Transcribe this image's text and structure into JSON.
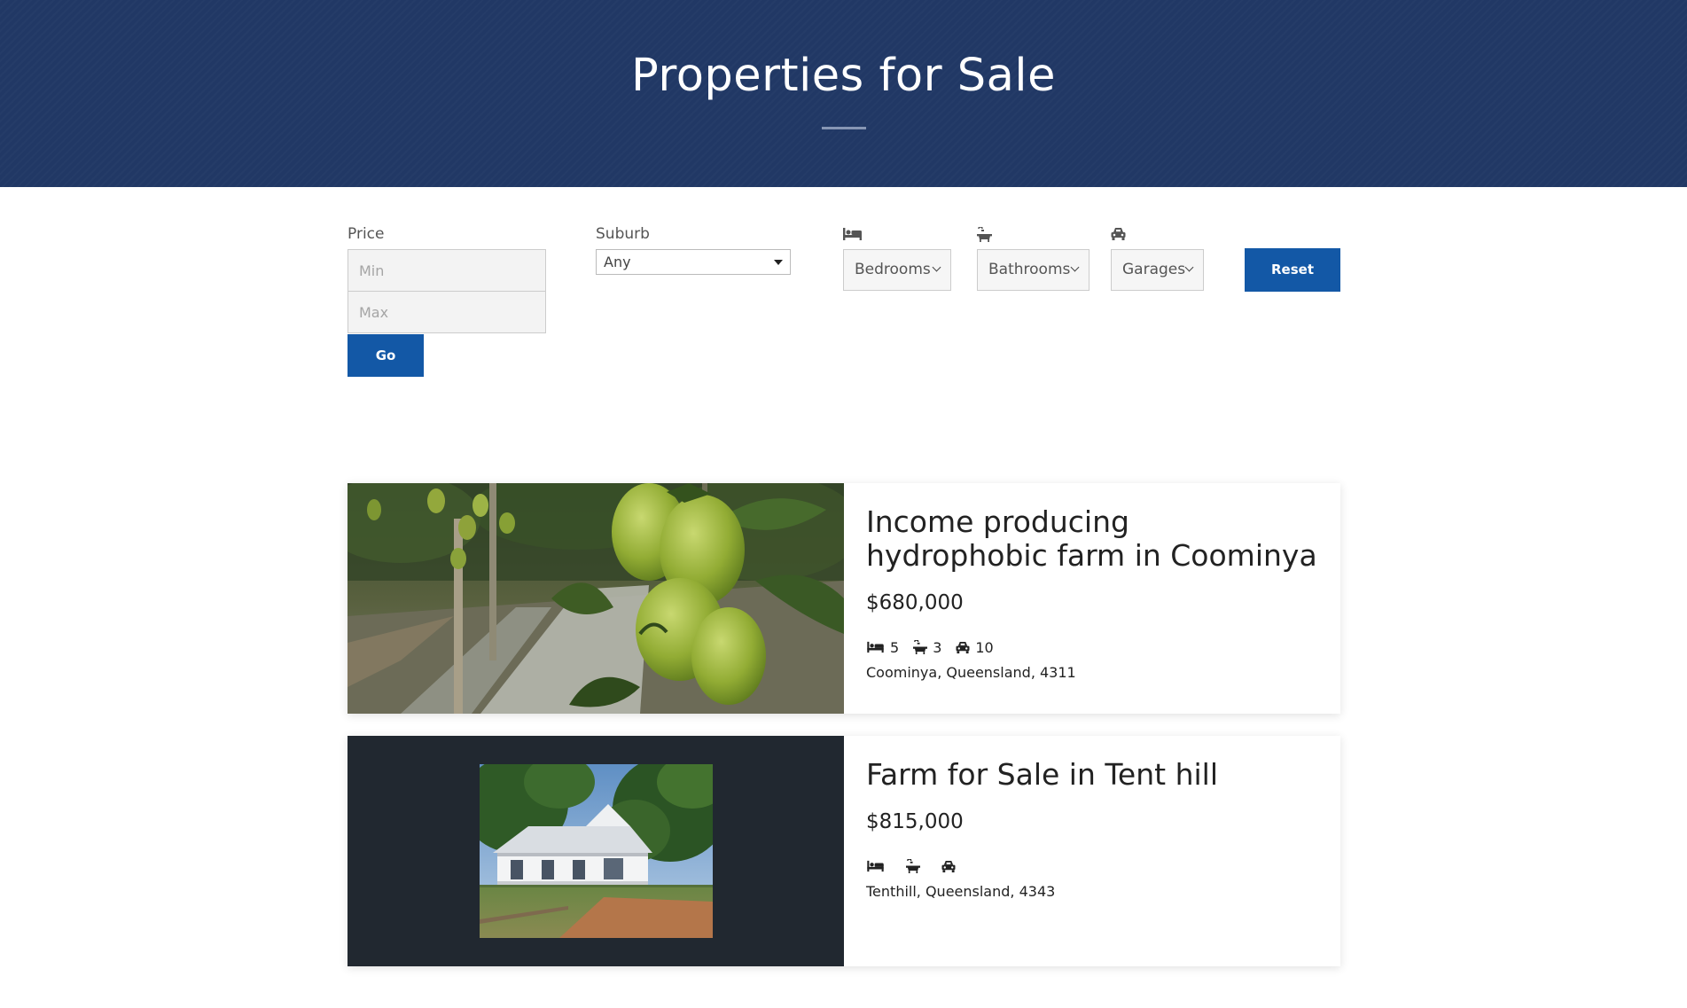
{
  "header": {
    "title": "Properties for Sale"
  },
  "filters": {
    "price_label": "Price",
    "min_placeholder": "Min",
    "max_placeholder": "Max",
    "go_label": "Go",
    "suburb_label": "Suburb",
    "suburb_value": "Any",
    "bedrooms_value": "Bedrooms",
    "bathrooms_value": "Bathrooms",
    "garages_value": "Garages",
    "reset_label": "Reset",
    "icons": [
      "bed-icon",
      "bath-icon",
      "car-icon"
    ]
  },
  "listings": [
    {
      "title": "Income producing hydrophobic farm in Coominya",
      "price": "$680,000",
      "bedrooms": "5",
      "bathrooms": "3",
      "garages": "10",
      "address": "Coominya, Queensland, 4311",
      "image": "tomato-plants-photo"
    },
    {
      "title": "Farm for Sale in Tent hill",
      "price": "$815,000",
      "bedrooms": "",
      "bathrooms": "",
      "garages": "",
      "address": "Tenthill, Queensland, 4343",
      "image": "farmhouse-photo"
    }
  ],
  "colors": {
    "header_bg": "#213865",
    "button_blue": "#1358a6",
    "dark_media_bg": "#212830"
  }
}
